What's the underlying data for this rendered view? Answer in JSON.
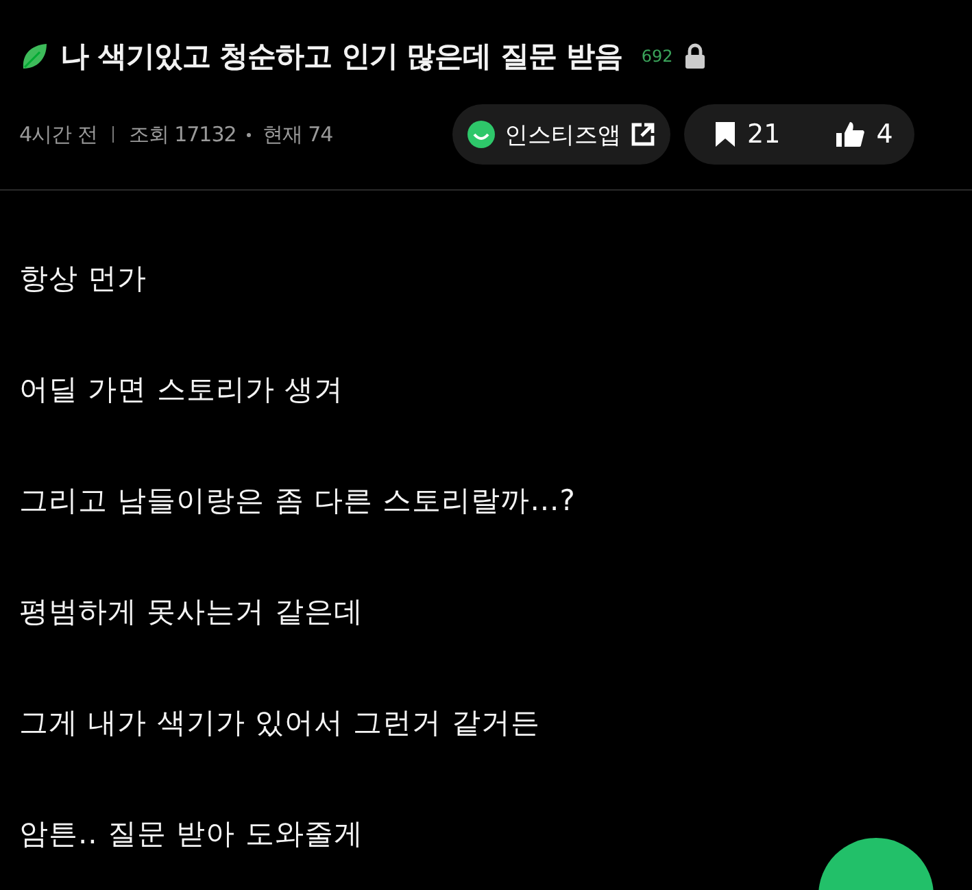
{
  "post": {
    "title": "나 색기있고 청순하고 인기 많은데 질문 받음",
    "title_count": "692",
    "locked": true,
    "time": "4시간 전",
    "views": "조회 17132",
    "current": "현재 74",
    "app_link": "인스티즈앱",
    "bookmarks": "21",
    "likes": "4"
  },
  "paragraphs": [
    "항상 먼가",
    "어딜 가면 스토리가 생겨",
    "그리고 남들이랑은 좀 다른 스토리랄까...?",
    "평범하게 못사는거 같은데",
    "그게 내가 색기가 있어서 그런거 같거든",
    "암튼.. 질문 받아 도와줄게"
  ]
}
